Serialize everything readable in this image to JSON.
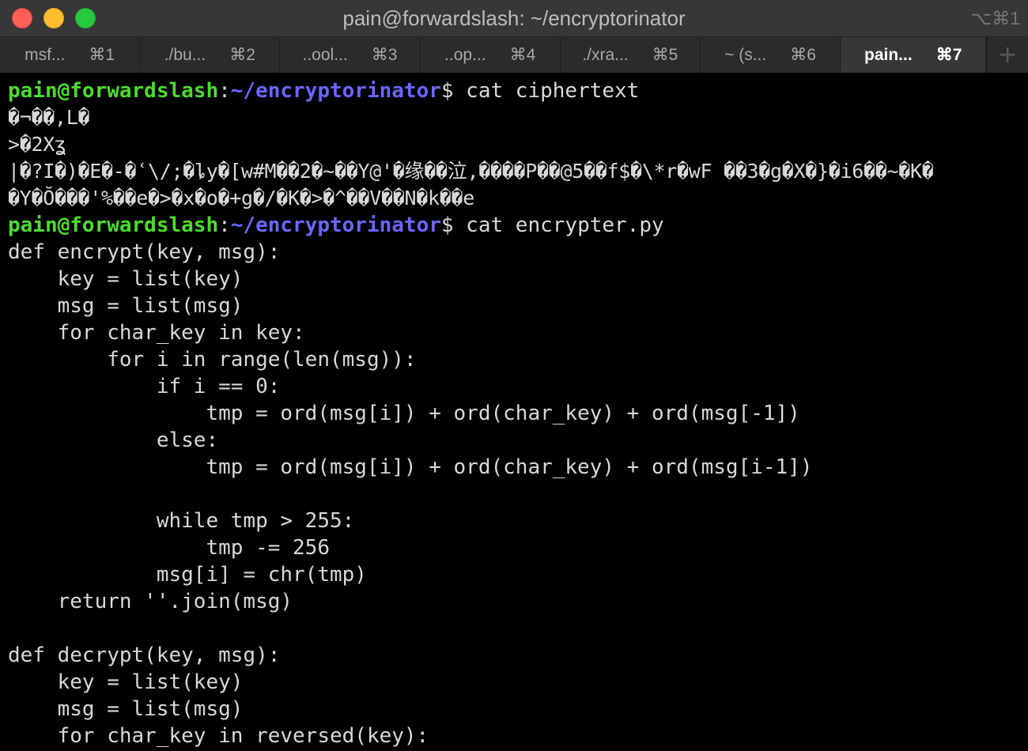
{
  "window": {
    "title": "pain@forwardslash: ~/encryptorinator",
    "shortcut": "⌥⌘1"
  },
  "traffic_lights": {
    "close": "×",
    "minimize": "−",
    "maximize": "+"
  },
  "tabs": [
    {
      "label": "msf...",
      "shortcut": "⌘1",
      "active": false
    },
    {
      "label": "./bu...",
      "shortcut": "⌘2",
      "active": false
    },
    {
      "label": "..ool...",
      "shortcut": "⌘3",
      "active": false
    },
    {
      "label": "..op...",
      "shortcut": "⌘4",
      "active": false
    },
    {
      "label": "./xra...",
      "shortcut": "⌘5",
      "active": false
    },
    {
      "label": "~ (s...",
      "shortcut": "⌘6",
      "active": false
    },
    {
      "label": "pain...",
      "shortcut": "⌘7",
      "active": true
    }
  ],
  "new_tab_label": "+",
  "prompt": {
    "user_host": "pain@forwardslash",
    "colon": ":",
    "path": "~/encryptorinator",
    "dollar": "$"
  },
  "terminal": {
    "cmd1": " cat ciphertext",
    "cipher": [
      "�¬��,L�",
      ">�2Xʓ",
      "|�?I�)�E�-�ʿ\\/;�ȴy�[w#M��2�~��Y@'�缘��泣,����P��@5��f$�\\*r�wF ��3�g�X�}�i6��~�K�",
      "�Y�Ŏ���'%��e�>�x�o�+g�/�K�>�^��V��N�k��e"
    ],
    "cmd2": " cat encrypter.py",
    "code": [
      "def encrypt(key, msg):",
      "    key = list(key)",
      "    msg = list(msg)",
      "    for char_key in key:",
      "        for i in range(len(msg)):",
      "            if i == 0:",
      "                tmp = ord(msg[i]) + ord(char_key) + ord(msg[-1])",
      "            else:",
      "                tmp = ord(msg[i]) + ord(char_key) + ord(msg[i-1])",
      "",
      "            while tmp > 255:",
      "                tmp -= 256",
      "            msg[i] = chr(tmp)",
      "    return ''.join(msg)",
      "",
      "def decrypt(key, msg):",
      "    key = list(key)",
      "    msg = list(msg)",
      "    for char_key in reversed(key):"
    ]
  }
}
